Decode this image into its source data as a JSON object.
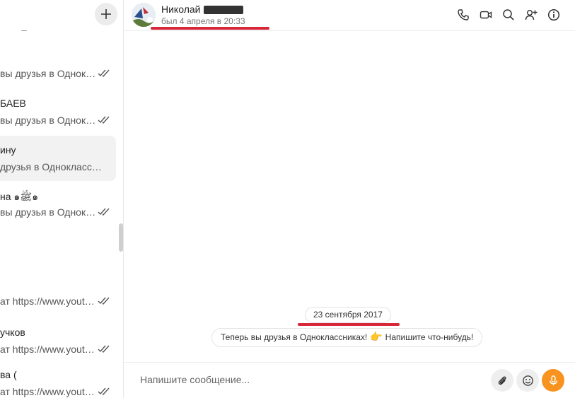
{
  "sidebar": {
    "add_label": "+",
    "chats": [
      {
        "name": "",
        "preview": "вы друзья в Однокл…",
        "read": true
      },
      {
        "name": "БАЕВ",
        "preview": "вы друзья в Однокл…",
        "read": true
      },
      {
        "name": "ину",
        "preview": "друзья в Одноклассн…",
        "read": false,
        "active": true
      },
      {
        "name": "на ๑ﷺ๑",
        "preview": "вы друзья в Однокл…",
        "read": true
      },
      {
        "name": "",
        "preview": "ат https://www.yout…",
        "read": true
      },
      {
        "name": "учков",
        "preview": "ат https://www.yout…",
        "read": true
      },
      {
        "name": "ва (",
        "preview": "ат https://www.yout…",
        "read": true
      }
    ]
  },
  "header": {
    "name": "Николай",
    "status": "был 4 апреля в 20:33",
    "icons": [
      "phone-icon",
      "video-icon",
      "search-icon",
      "add-user-icon",
      "info-icon"
    ]
  },
  "messages": {
    "date": "23 сентября 2017",
    "system_before": "Теперь вы друзья в Одноклассниках!",
    "system_emoji": "👉",
    "system_after": "Напишите что-нибудь!"
  },
  "composer": {
    "placeholder": "Напишите сообщение..."
  },
  "colors": {
    "accent": "#f7931e",
    "annotation_red": "#d8263a"
  }
}
